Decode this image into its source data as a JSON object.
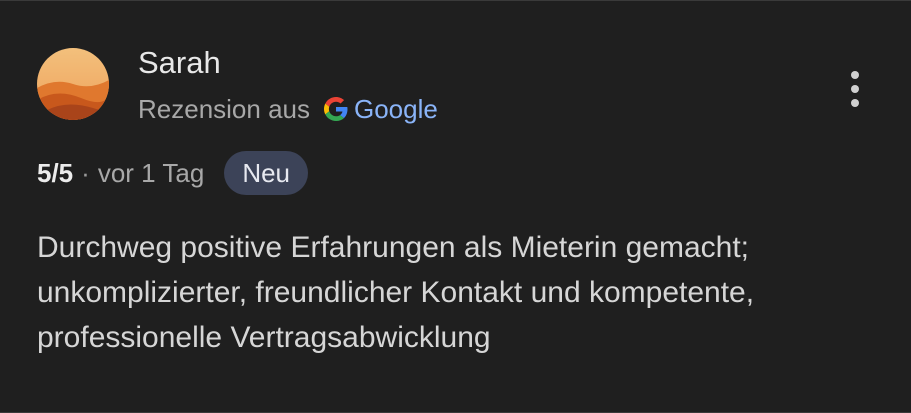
{
  "review": {
    "author": "Sarah",
    "source_prefix": "Rezension aus",
    "source_name": "Google",
    "rating": "5/5",
    "separator": "·",
    "time": "vor 1 Tag",
    "badge": "Neu",
    "text": "Durchweg positive Erfahrungen als Mieterin gemacht; unkomplizierter, freundlicher Kontakt und kompetente, professionelle Vertragsabwicklung",
    "avatar_icon": "desert-dunes-avatar",
    "menu_icon": "more-vert-icon"
  },
  "colors": {
    "background": "#1f1f1f",
    "google_link": "#8ab4f8",
    "badge_bg": "#3c4358"
  }
}
